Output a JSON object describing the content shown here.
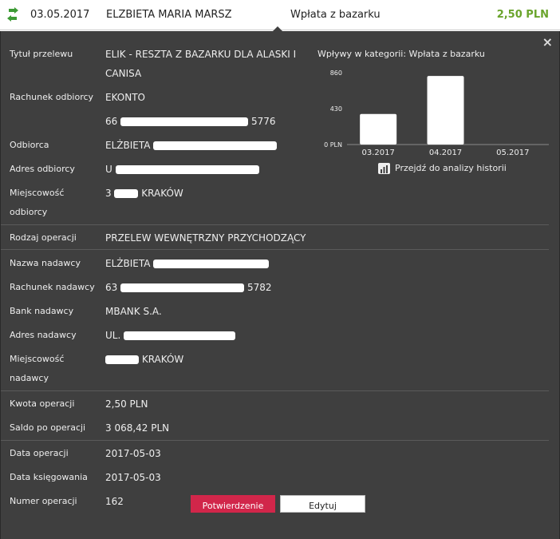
{
  "header": {
    "date": "03.05.2017",
    "name": "ELŻBIETA MARIA MARSZ",
    "category": "Wpłata z bazarku",
    "amount": "2,50 PLN",
    "amount_color": "#6aa42c",
    "icon": "transfer-arrows-icon"
  },
  "details": {
    "rows": [
      {
        "label": "Tytuł przelewu",
        "value": "ELIK - RESZTA Z BAZARKU DLA ALASKI I",
        "value2": "CANISA"
      },
      {
        "label": "Rachunek odbiorcy",
        "value": "EKONTO",
        "value2_prefix": "66",
        "value2_suffix": "5776"
      },
      {
        "label": "Odbiorca",
        "value": "ELŻBIETA"
      },
      {
        "label": "Adres odbiorcy",
        "value": "U"
      },
      {
        "label": "Miejscowość",
        "label2": "odbiorcy",
        "value_prefix": "3",
        "value": "KRAKÓW"
      },
      {
        "label": "Rodzaj operacji",
        "value": "PRZELEW WEWNĘTRZNY PRZYCHODZĄCY"
      },
      {
        "label": "Nazwa nadawcy",
        "value": "ELŻBIETA"
      },
      {
        "label": "Rachunek nadawcy",
        "value_prefix": "63",
        "value": "5782"
      },
      {
        "label": "Bank nadawcy",
        "value": "MBANK S.A."
      },
      {
        "label": "Adres nadawcy",
        "value": "UL."
      },
      {
        "label": "Miejscowość",
        "label2": "nadawcy",
        "value": "KRAKÓW"
      },
      {
        "label": "Kwota operacji",
        "value": "2,50 PLN"
      },
      {
        "label": "Saldo po operacji",
        "value": "3 068,42 PLN"
      },
      {
        "label": "Data operacji",
        "value": "2017-05-03"
      },
      {
        "label": "Data księgowania",
        "value": "2017-05-03"
      },
      {
        "label": "Numer operacji",
        "value": "162"
      }
    ]
  },
  "chart_data": {
    "type": "bar",
    "title": "Wpływy w kategorii:  Wpłata z bazarku",
    "categories": [
      "03.2017",
      "04.2017",
      "05.2017"
    ],
    "values": [
      365,
      820,
      0
    ],
    "ytick_labels": [
      "0 PLN",
      "430",
      "860"
    ],
    "yticks": [
      0,
      430,
      860
    ],
    "ylim": [
      0,
      860
    ],
    "bar_color": "#ffffff"
  },
  "chart_link": "Przejdź do analizy historii",
  "buttons": {
    "confirm": "Potwierdzenie",
    "edit": "Edytuj",
    "confirm_color": "#d1264a"
  },
  "close_label": "×"
}
